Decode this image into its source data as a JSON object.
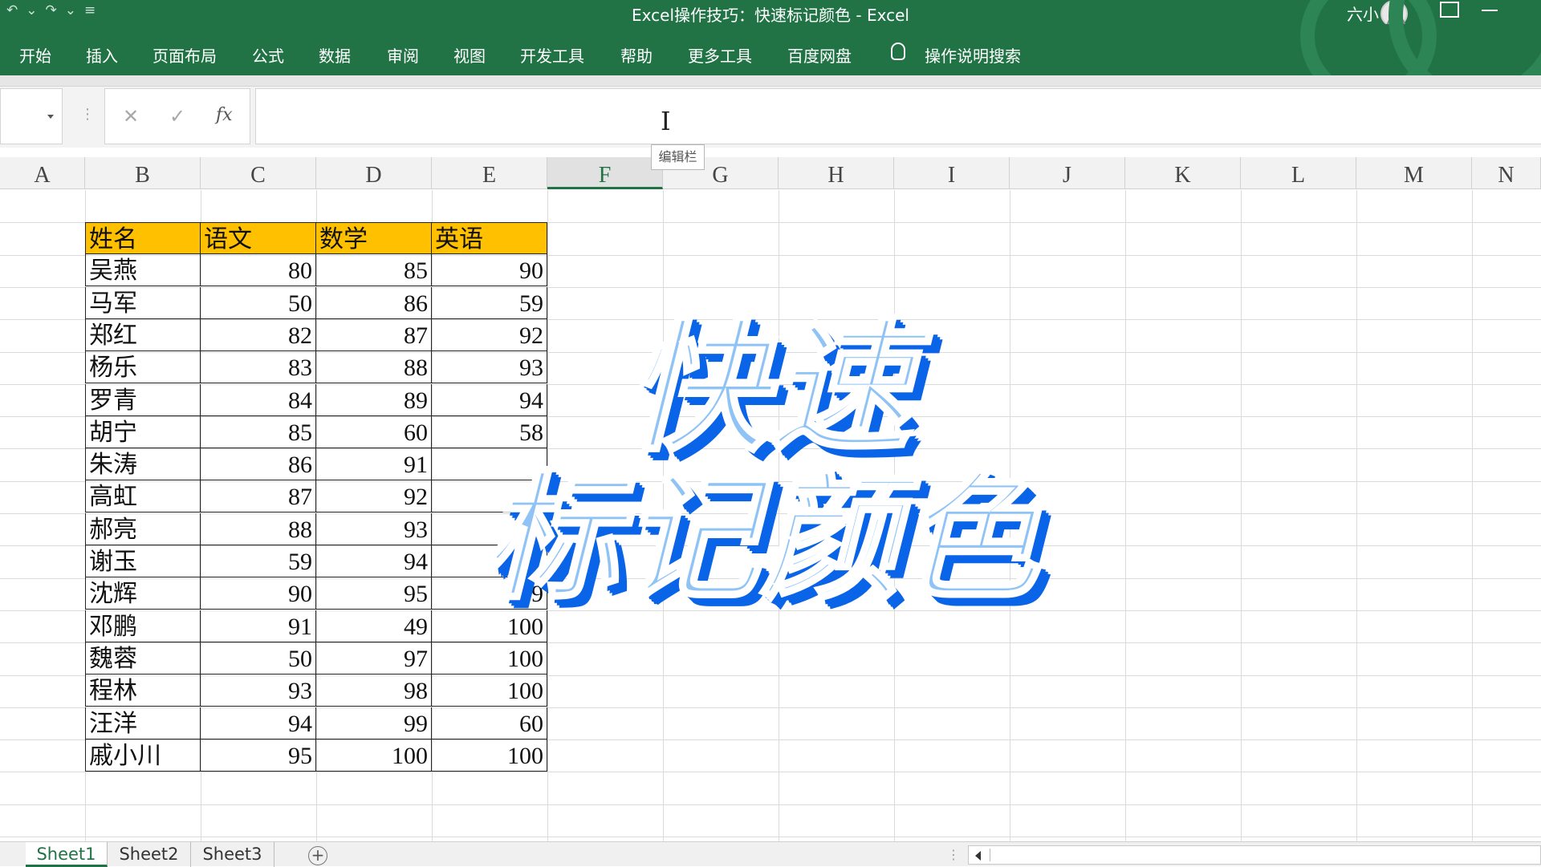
{
  "window": {
    "title": "Excel操作技巧：快速标记颜色  -  Excel",
    "user": "六小"
  },
  "qat": {
    "undo_icon": "undo-icon",
    "redo_icon": "redo-icon",
    "customize_icon": "customize-icon"
  },
  "ribbon_tabs": [
    "开始",
    "插入",
    "页面布局",
    "公式",
    "数据",
    "审阅",
    "视图",
    "开发工具",
    "帮助",
    "更多工具",
    "百度网盘"
  ],
  "tell_me": "操作说明搜索",
  "formula_bar": {
    "name_box": "",
    "cancel": "✕",
    "enter": "✓",
    "fx": "fx",
    "value": "",
    "tooltip": "编辑栏"
  },
  "columns": [
    "A",
    "B",
    "C",
    "D",
    "E",
    "F",
    "G",
    "H",
    "I",
    "J",
    "K",
    "L",
    "M",
    "N"
  ],
  "selected_column": "F",
  "table": {
    "headers": [
      "姓名",
      "语文",
      "数学",
      "英语"
    ],
    "header_color": "#FFC000",
    "rows": [
      [
        "吴燕",
        "80",
        "85",
        "90"
      ],
      [
        "马军",
        "50",
        "86",
        "59"
      ],
      [
        "郑红",
        "82",
        "87",
        "92"
      ],
      [
        "杨乐",
        "83",
        "88",
        "93"
      ],
      [
        "罗青",
        "84",
        "89",
        "94"
      ],
      [
        "胡宁",
        "85",
        "60",
        "58"
      ],
      [
        "朱涛",
        "86",
        "91",
        ""
      ],
      [
        "高虹",
        "87",
        "92",
        ""
      ],
      [
        "郝亮",
        "88",
        "93",
        ""
      ],
      [
        "谢玉",
        "59",
        "94",
        ""
      ],
      [
        "沈辉",
        "90",
        "95",
        "59"
      ],
      [
        "邓鹏",
        "91",
        "49",
        "100"
      ],
      [
        "魏蓉",
        "50",
        "97",
        "100"
      ],
      [
        "程林",
        "93",
        "98",
        "100"
      ],
      [
        "汪洋",
        "94",
        "99",
        "60"
      ],
      [
        "戚小川",
        "95",
        "100",
        "100"
      ]
    ]
  },
  "overlay": {
    "line1": "快速",
    "line2": "标记颜色",
    "fill_color": "#8FC3F6",
    "shadow_color": "#0A64E8"
  },
  "sheets": [
    "Sheet1",
    "Sheet2",
    "Sheet3"
  ],
  "active_sheet": "Sheet1",
  "add_sheet": "+"
}
